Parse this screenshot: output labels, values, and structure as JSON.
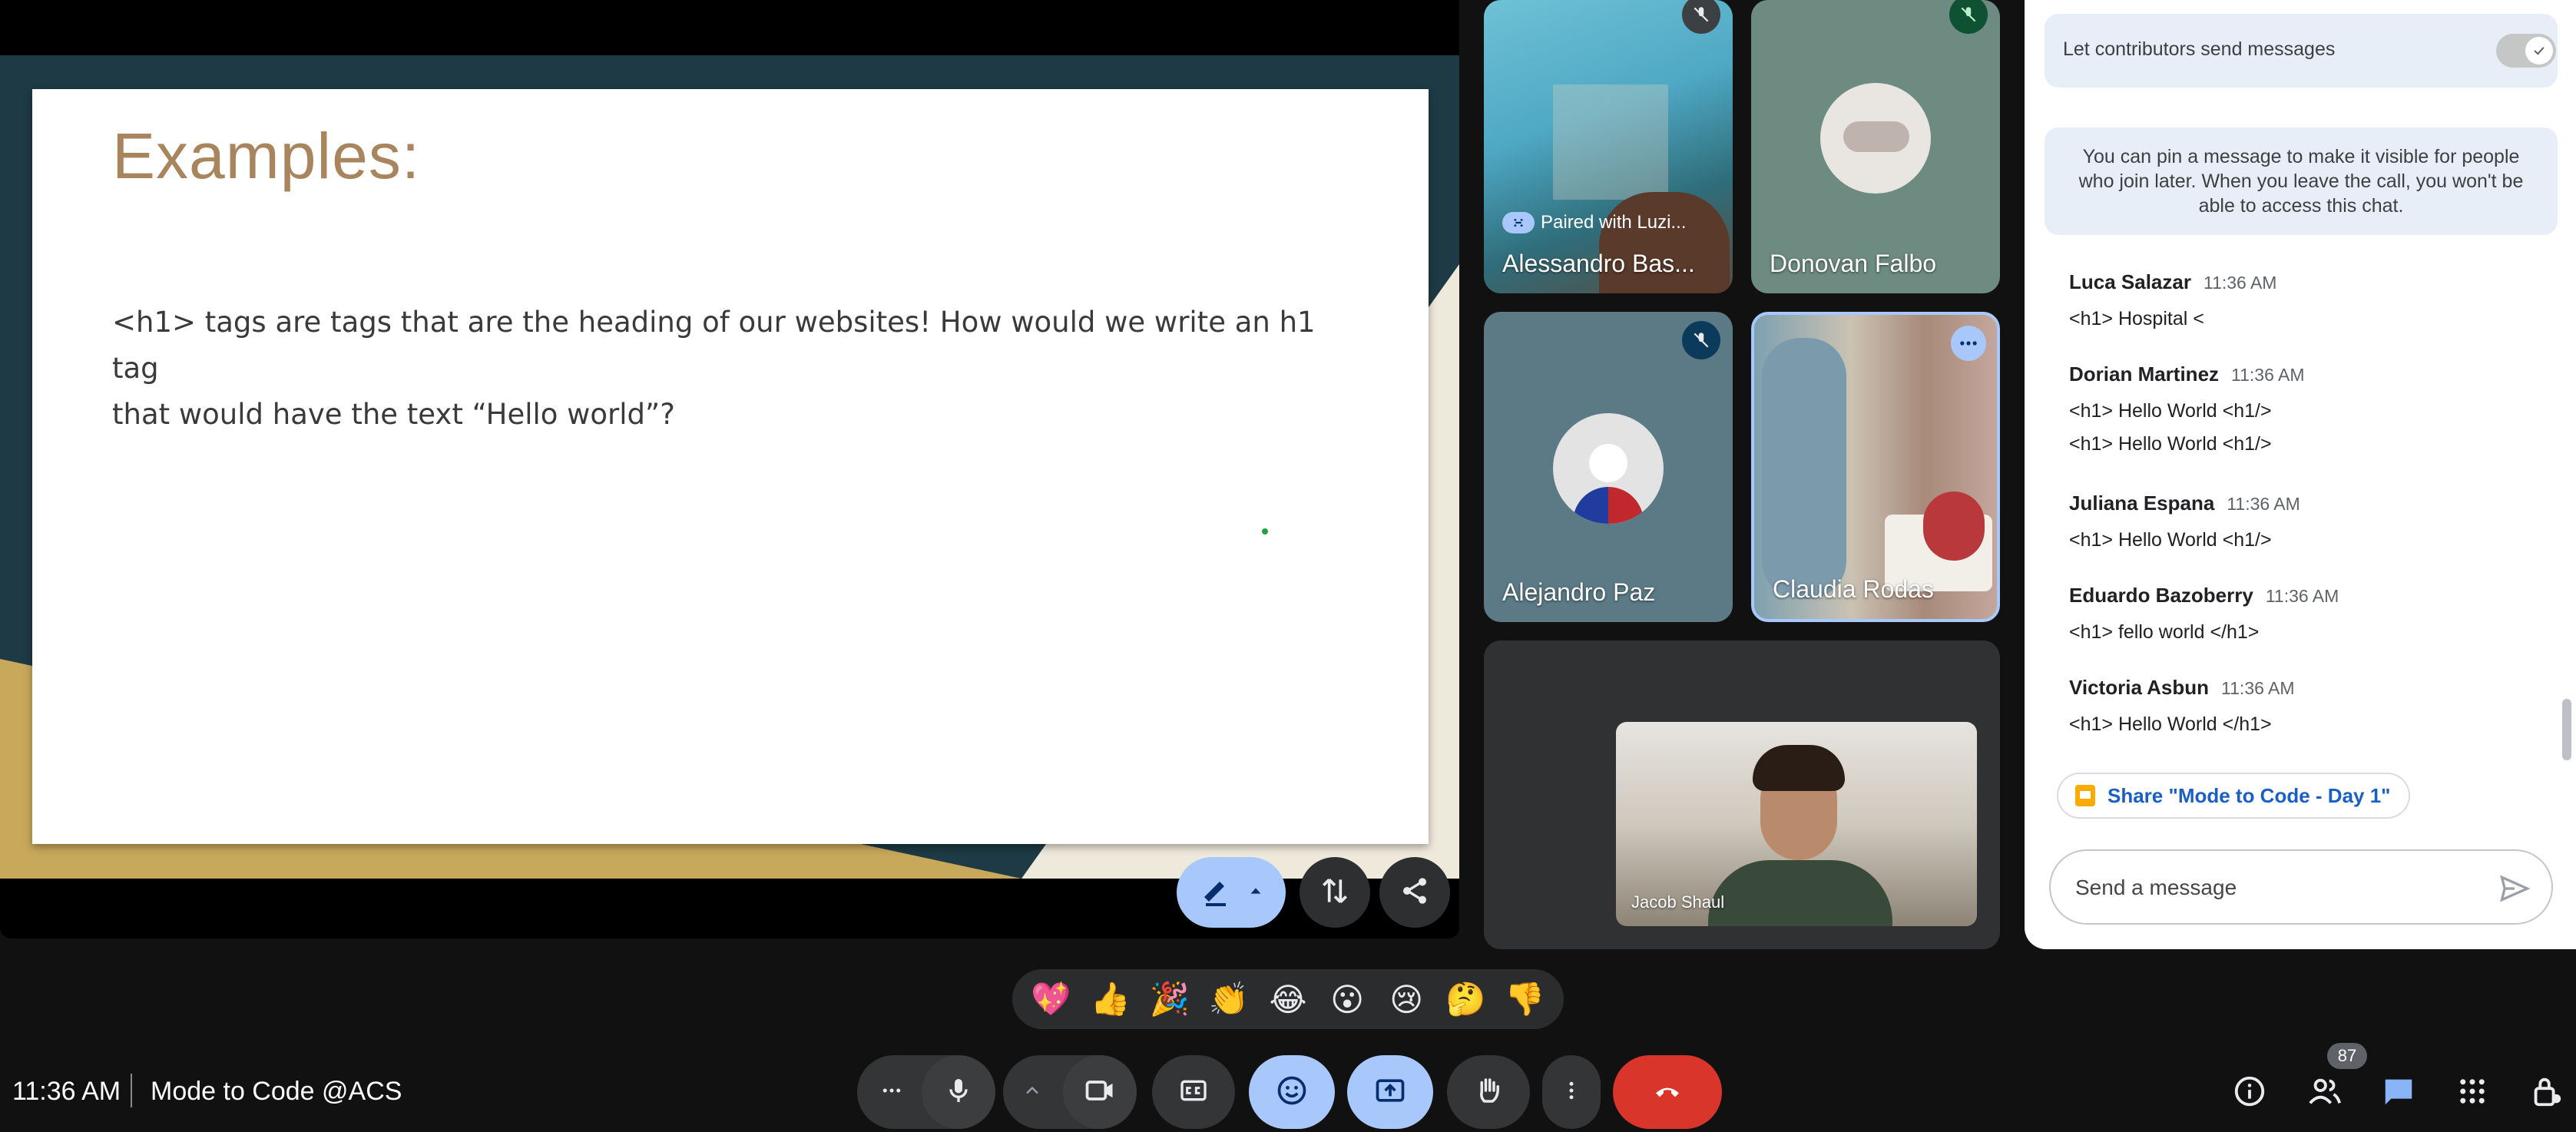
{
  "slide": {
    "title": "Examples:",
    "body_line1": "<h1> tags are tags that are the heading of our websites! How would we write an h1 tag",
    "body_line2": "that would have the text “Hello world”?"
  },
  "participants": {
    "alessandro": {
      "name": "Alessandro Bas...",
      "pair_label": "Paired with Luzi..."
    },
    "donovan": {
      "name": "Donovan Falbo"
    },
    "alejandro": {
      "name": "Alejandro Paz"
    },
    "claudia": {
      "name": "Claudia Rodas"
    },
    "jacob": {
      "name": "Jacob Shaul"
    }
  },
  "chat": {
    "contributors_label": "Let contributors send messages",
    "pin_note": "You can pin a message to make it visible for people who join later. When you leave the call, you won't be able to access this chat.",
    "messages": [
      {
        "author": "Luca Salazar",
        "time": "11:36 AM",
        "lines": [
          "<h1> Hospital <"
        ]
      },
      {
        "author": "Dorian Martinez",
        "time": "11:36 AM",
        "lines": [
          "<h1> Hello World <h1/>",
          "<h1> Hello World <h1/>"
        ]
      },
      {
        "author": "Juliana Espana",
        "time": "11:36 AM",
        "lines": [
          "<h1> Hello World <h1/>"
        ]
      },
      {
        "author": "Eduardo Bazoberry",
        "time": "11:36 AM",
        "lines": [
          "<h1> fello world </h1>"
        ]
      },
      {
        "author": "Victoria Asbun",
        "time": "11:36 AM",
        "lines": [
          "<h1> Hello World </h1>"
        ]
      }
    ],
    "share_chip": "Share \"Mode to Code - Day 1\"",
    "input_placeholder": "Send a message"
  },
  "reactions": [
    "💖",
    "👍",
    "🎉",
    "👏",
    "😂",
    "😮",
    "😢",
    "🤔",
    "👎"
  ],
  "bottom_bar": {
    "time": "11:36 AM",
    "meeting_name": "Mode to Code @ACS",
    "people_count": "87"
  },
  "colors": {
    "accent_blue": "#a8c7fa",
    "leave_red": "#d9352b",
    "slide_title": "#a9855e"
  },
  "icons": [
    "mic-off-icon",
    "link-icon",
    "more-horiz-icon",
    "pen-icon",
    "swap-icon",
    "share-icon",
    "mic-icon",
    "chevron-up-icon",
    "camera-icon",
    "captions-icon",
    "emoji-icon",
    "present-icon",
    "hand-icon",
    "more-vert-icon",
    "call-end-icon",
    "info-icon",
    "people-icon",
    "chat-icon",
    "apps-icon",
    "lock-person-icon",
    "send-icon"
  ]
}
